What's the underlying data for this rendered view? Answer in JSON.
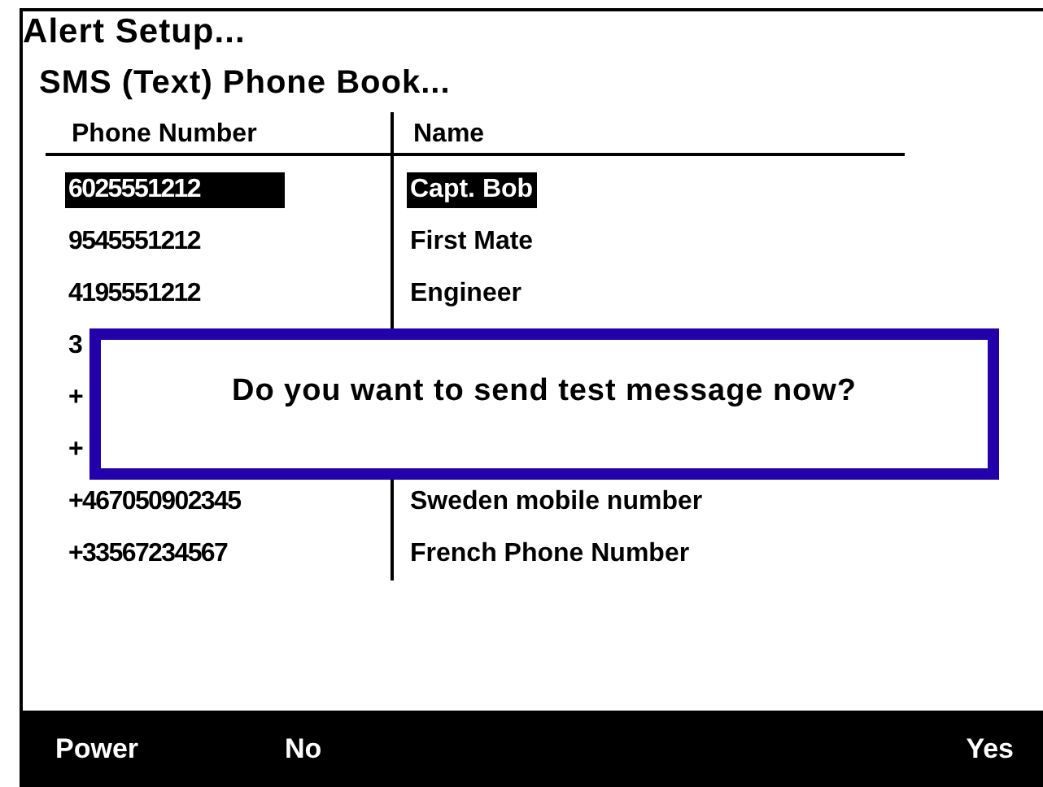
{
  "title": "Alert Setup...",
  "subtitle": "SMS (Text) Phone Book...",
  "table": {
    "columns": [
      "Phone Number",
      "Name"
    ],
    "rows": [
      {
        "phone": "6025551212",
        "name": "Capt. Bob",
        "selected": true
      },
      {
        "phone": "9545551212",
        "name": "First Mate",
        "selected": false
      },
      {
        "phone": "4195551212",
        "name": "Engineer",
        "selected": false
      },
      {
        "phone": "3",
        "selected": false
      },
      {
        "phone": "+",
        "selected": false
      },
      {
        "phone": "+",
        "selected": false
      },
      {
        "phone": "+467050902345",
        "name": "Sweden mobile number",
        "selected": false
      },
      {
        "phone": "+33567234567",
        "name": "French Phone Number",
        "selected": false
      }
    ]
  },
  "dialog": {
    "message": "Do you want to send test message now?"
  },
  "left_keys": [
    "Power",
    "No"
  ],
  "right_keys": [
    "Yes"
  ]
}
